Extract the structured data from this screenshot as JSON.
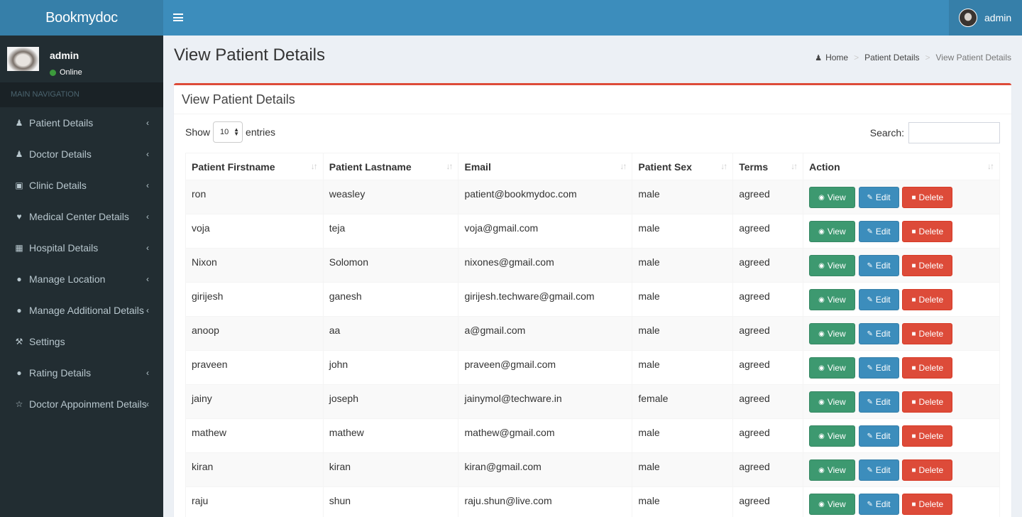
{
  "app": {
    "brand": "Bookmydoc"
  },
  "topbar": {
    "menu_icon": "hamburger-icon",
    "user_name": "admin"
  },
  "sidebar": {
    "user": {
      "name": "admin",
      "status": "Online"
    },
    "nav_header": "MAIN NAVIGATION",
    "items": [
      {
        "label": "Patient Details",
        "icon": "male-icon",
        "glyph": "♟",
        "has_children": true
      },
      {
        "label": "Doctor Details",
        "icon": "user-md-icon",
        "glyph": "♟",
        "has_children": true
      },
      {
        "label": "Clinic Details",
        "icon": "h-square-icon",
        "glyph": "▣",
        "has_children": true
      },
      {
        "label": "Medical Center Details",
        "icon": "heartbeat-icon",
        "glyph": "♥",
        "has_children": true
      },
      {
        "label": "Hospital Details",
        "icon": "hospital-icon",
        "glyph": "▦",
        "has_children": true
      },
      {
        "label": "Manage Location",
        "icon": "globe-icon",
        "glyph": "●",
        "has_children": true
      },
      {
        "label": "Manage Additional Details",
        "icon": "globe-icon",
        "glyph": "●",
        "has_children": true
      },
      {
        "label": "Settings",
        "icon": "wrench-icon",
        "glyph": "⚒",
        "has_children": false
      },
      {
        "label": "Rating Details",
        "icon": "globe-icon",
        "glyph": "●",
        "has_children": true
      },
      {
        "label": "Doctor Appoinment Details",
        "icon": "star-outline-icon",
        "glyph": "☆",
        "has_children": true
      }
    ],
    "chevron": "‹"
  },
  "page": {
    "title": "View Patient Details",
    "breadcrumb": {
      "home": "Home",
      "section": "Patient Details",
      "current": "View Patient Details",
      "separator": ">"
    }
  },
  "box": {
    "title": "View Patient Details",
    "length": {
      "show": "Show",
      "value": "10",
      "entries": "entries"
    },
    "search": {
      "label": "Search:",
      "value": ""
    },
    "sort_glyph": "↓↑",
    "columns": [
      "Patient Firstname",
      "Patient Lastname",
      "Email",
      "Patient Sex",
      "Terms",
      "Action"
    ],
    "actions": {
      "view": "View",
      "edit": "Edit",
      "delete": "Delete"
    },
    "rows": [
      {
        "first": "ron",
        "last": "weasley",
        "email": "patient@bookmydoc.com",
        "sex": "male",
        "terms": "agreed"
      },
      {
        "first": "voja",
        "last": "teja",
        "email": "voja@gmail.com",
        "sex": "male",
        "terms": "agreed"
      },
      {
        "first": "Nixon",
        "last": "Solomon",
        "email": "nixones@gmail.com",
        "sex": "male",
        "terms": "agreed"
      },
      {
        "first": "girijesh",
        "last": "ganesh",
        "email": "girijesh.techware@gmail.com",
        "sex": "male",
        "terms": "agreed"
      },
      {
        "first": "anoop",
        "last": "aa",
        "email": "a@gmail.com",
        "sex": "male",
        "terms": "agreed"
      },
      {
        "first": "praveen",
        "last": "john",
        "email": "praveen@gmail.com",
        "sex": "male",
        "terms": "agreed"
      },
      {
        "first": "jainy",
        "last": "joseph",
        "email": "jainymol@techware.in",
        "sex": "female",
        "terms": "agreed"
      },
      {
        "first": "mathew",
        "last": "mathew",
        "email": "mathew@gmail.com",
        "sex": "male",
        "terms": "agreed"
      },
      {
        "first": "kiran",
        "last": "kiran",
        "email": "kiran@gmail.com",
        "sex": "male",
        "terms": "agreed"
      },
      {
        "first": "raju",
        "last": "shun",
        "email": "raju.shun@live.com",
        "sex": "male",
        "terms": "agreed"
      }
    ]
  },
  "colors": {
    "header": "#3c8dbc",
    "header_dark": "#367fa9",
    "sidebar": "#222d32",
    "box_accent": "#dd4b39",
    "view": "#3d9970",
    "edit": "#3c8dbc",
    "delete": "#dd4b39"
  }
}
